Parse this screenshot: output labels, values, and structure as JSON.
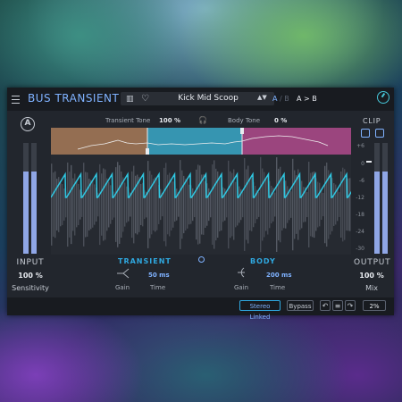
{
  "header": {
    "title": "BUS TRANSIENT",
    "preset_name": "Kick Mid Scoop",
    "ab_a": "A",
    "ab_sep": "/",
    "ab_b": "B",
    "a_to_b": "A > B"
  },
  "tones": {
    "transient_label": "Transient Tone",
    "transient_value": "100 %",
    "body_label": "Body Tone",
    "body_value": "0 %"
  },
  "input": {
    "label": "INPUT",
    "value": "100 %",
    "sublabel": "Sensitivity"
  },
  "output": {
    "label": "OUTPUT",
    "value": "100 %",
    "sublabel": "Mix"
  },
  "clip": {
    "label": "CLIP",
    "scale": [
      "+6",
      "0",
      "-6",
      "-12",
      "-18",
      "-24",
      "-30"
    ]
  },
  "transient": {
    "label": "TRANSIENT",
    "gain_label": "Gain",
    "time_label": "Time",
    "time_value": "50 ms"
  },
  "body": {
    "label": "BODY",
    "gain_label": "Gain",
    "time_label": "Time",
    "time_value": "200 ms"
  },
  "footer": {
    "stereo_linked": "Stereo Linked",
    "bypass": "Bypass",
    "undo_icon": "↶",
    "history_icon": "≡",
    "redo_icon": "↷",
    "zoom": "2%"
  },
  "colors": {
    "accent": "#7fb2ff",
    "transient_band": "#a87a58",
    "mid_band": "#3aa8c8",
    "body_band": "#b04a8c",
    "wave_line": "#2fc6e0"
  }
}
